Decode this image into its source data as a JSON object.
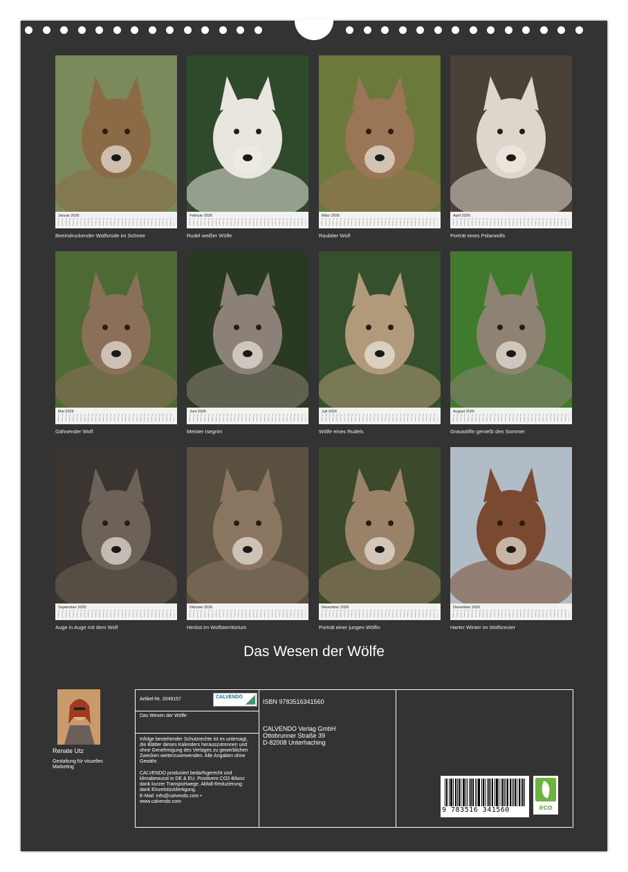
{
  "calendar": {
    "title": "Das Wesen der Wölfe",
    "months": [
      {
        "label": "Januar 2026",
        "caption": "Beeindruckender Wolfsrüde im Schnee",
        "bg": "#7a8a5a",
        "fur": "#8b6b45"
      },
      {
        "label": "Februar 2026",
        "caption": "Rudel weißer Wölfe",
        "bg": "#2f4a2a",
        "fur": "#e8e6df"
      },
      {
        "label": "März 2026",
        "caption": "Raubtier Wolf",
        "bg": "#6b7a3a",
        "fur": "#9a7556"
      },
      {
        "label": "April 2026",
        "caption": "Porträt eines Polarwolfs",
        "bg": "#4a4238",
        "fur": "#dcd6cc"
      },
      {
        "label": "Mai 2026",
        "caption": "Gähnender Wolf",
        "bg": "#4d6a35",
        "fur": "#8a7058"
      },
      {
        "label": "Juni 2026",
        "caption": "Meister Isegrim",
        "bg": "#2a3a22",
        "fur": "#8c8178"
      },
      {
        "label": "Juli 2026",
        "caption": "Wölfe eines Rudels",
        "bg": "#35502c",
        "fur": "#b09a7a"
      },
      {
        "label": "August 2026",
        "caption": "Grauwölfin genießt den Sommer",
        "bg": "#3f7a2d",
        "fur": "#8e8272"
      },
      {
        "label": "September 2026",
        "caption": "Auge in Auge mit dem Wolf",
        "bg": "#3a3530",
        "fur": "#6d6258"
      },
      {
        "label": "Oktober 2026",
        "caption": "Herbst im Wolfsterritorium",
        "bg": "#5a5040",
        "fur": "#8a7660"
      },
      {
        "label": "November 2026",
        "caption": "Porträt einer jungen Wölfin",
        "bg": "#3a4a2a",
        "fur": "#9a8268"
      },
      {
        "label": "Dezember 2026",
        "caption": "Harter Winter im Wolfsrevier",
        "bg": "#b0bcc6",
        "fur": "#7a4a30"
      }
    ]
  },
  "author": {
    "name": "Renate Utz",
    "role": "Gestaltung für visuelles Marketing"
  },
  "info": {
    "article": "Artikel-Nr. 2049157",
    "logo_text": "CALVENDO",
    "product_title": "Das Wesen der Wölfe",
    "legal": "Infolge bestehender Schutzrechte ist es untersagt, die Blätter dieses Kalenders herauszutrennen und ohne Genehmigung des Verlages zu gewerblichen Zwecken weiterzuverwenden. Alle Angaben ohne Gewähr.",
    "eco_note": "CALVENDO produziert bedarfsgerecht und klimabewusst in DE & EU. Positivere CO2-Bilanz dank kurzer Transportwege. Abfall-Reduzierung dank Einzelstückfertigung.",
    "contact": "E-Mail: info@calvendo.com • www.calvendo.com",
    "isbn": "ISBN 9783516341560",
    "publisher_line1": "CALVENDO Verlag GmbH",
    "publisher_line2": "Ottobrunner Straße 39",
    "publisher_line3": "D-82008 Unterhaching",
    "barcode_digits": "9 783516 341560",
    "eco_label": "eco"
  }
}
